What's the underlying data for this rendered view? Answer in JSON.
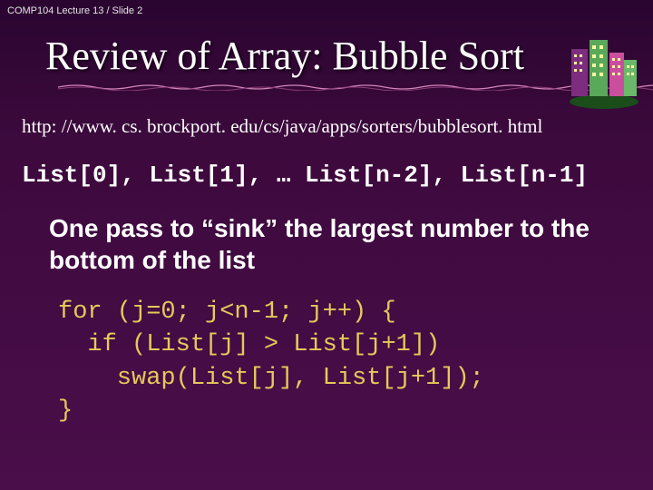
{
  "header": "COMP104 Lecture 13 / Slide 2",
  "title": "Review of Array: Bubble Sort",
  "url": "http: //www. cs. brockport. edu/cs/java/apps/sorters/bubblesort. html",
  "array_line": "List[0], List[1], … List[n-2], List[n-1]",
  "description": "One pass to “sink” the largest number to the bottom of the list",
  "code": "for (j=0; j<n-1; j++) {\n  if (List[j] > List[j+1])\n    swap(List[j], List[j+1]);\n}"
}
